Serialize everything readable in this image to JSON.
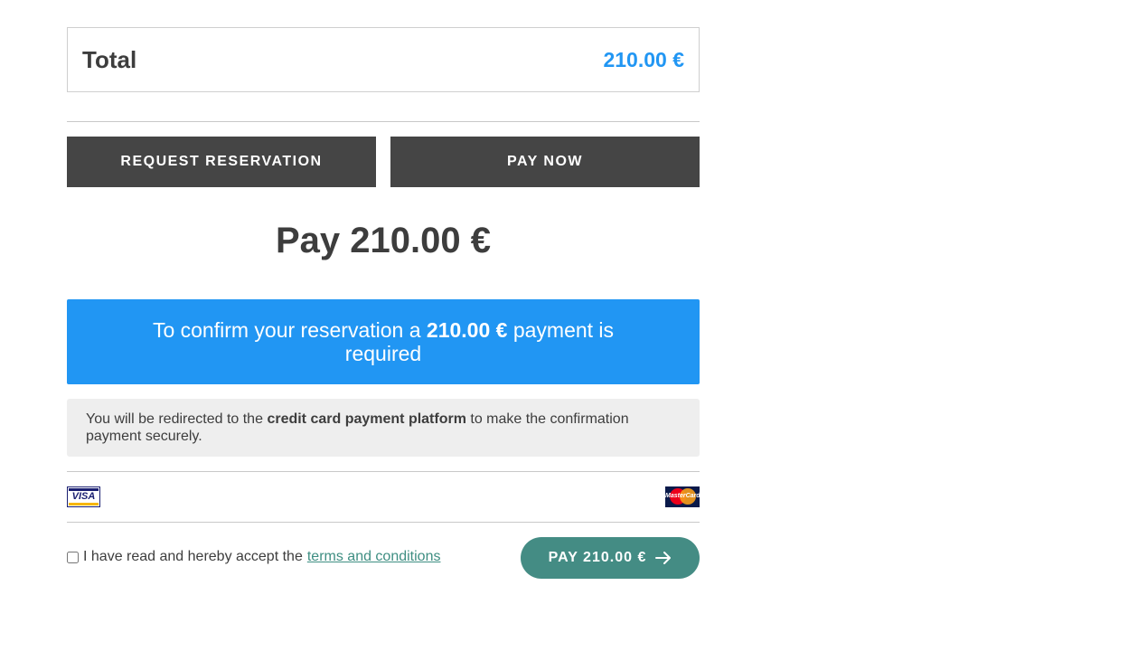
{
  "summary": {
    "total_label": "Total",
    "total_value": "210.00 €"
  },
  "actions": {
    "request_reservation_label": "REQUEST RESERVATION",
    "pay_now_label": "PAY NOW"
  },
  "payment": {
    "heading": "Pay 210.00 €",
    "confirm_prefix": "To confirm your reservation a",
    "confirm_amount": "210.00 €",
    "confirm_suffix": "payment is required",
    "redirect_prefix": "You will be redirected to the",
    "redirect_bold": "credit card payment platform",
    "redirect_suffix": "to make the confirmation payment securely."
  },
  "cards": {
    "visa_label": "VISA",
    "mastercard_label": "MasterCard",
    "visa_icon": "visa-card-icon",
    "mastercard_icon": "mastercard-card-icon"
  },
  "terms": {
    "checked": false,
    "text": "I have read and hereby accept the",
    "link_text": "terms and conditions"
  },
  "submit": {
    "label": "PAY 210.00 €",
    "icon": "arrow-right-icon"
  },
  "colors": {
    "accent_blue": "#2196f3",
    "dark_button": "#454545",
    "teal_button": "#448c84",
    "link": "#3e8e82",
    "info_bg": "#eeeeee"
  }
}
